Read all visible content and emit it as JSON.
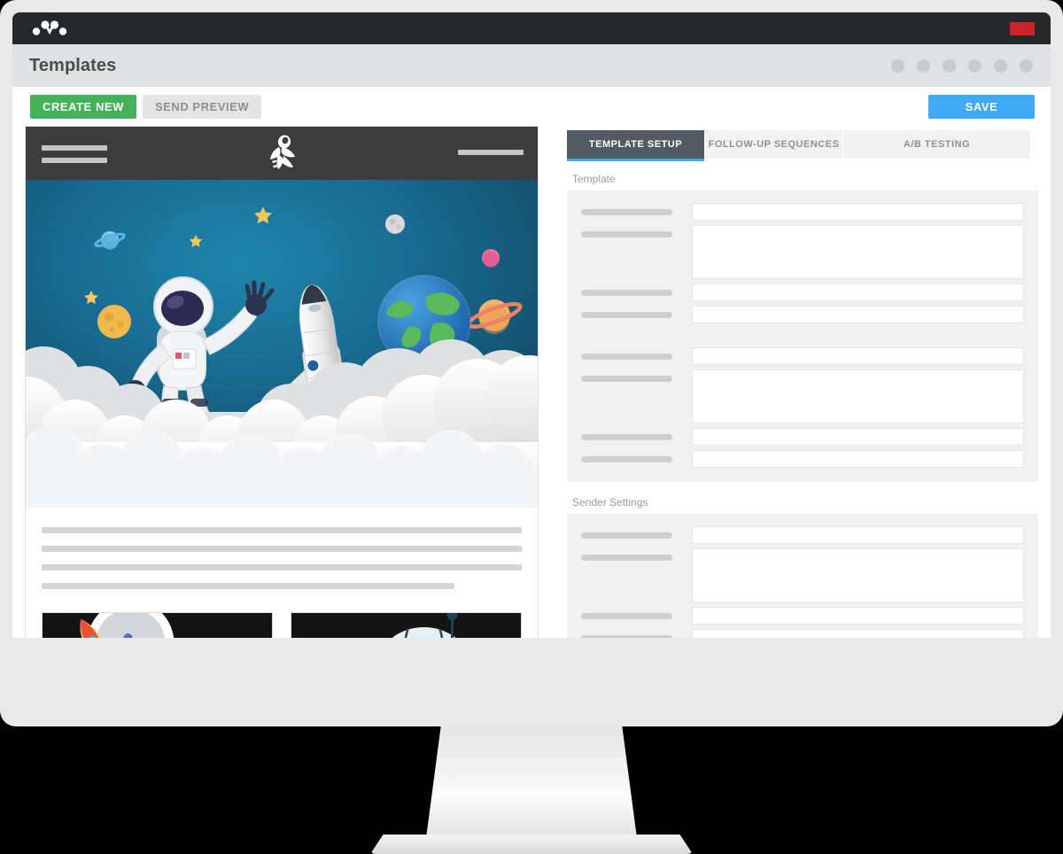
{
  "app": {
    "logo_icon": "mautic-logo-icon",
    "top_badge_icon": "red-badge-indicator",
    "page_title": "Templates",
    "header_dots_count": 6
  },
  "toolbar": {
    "create_new_label": "CREATE NEW",
    "send_preview_label": "SEND PREVIEW",
    "save_label": "SAVE"
  },
  "tabs": [
    {
      "label": "TEMPLATE SETUP",
      "active": true
    },
    {
      "label": "FOLLOW-UP SEQUENCES",
      "active": false
    },
    {
      "label": "A/B TESTING",
      "active": false
    }
  ],
  "sections": [
    {
      "label": "Template",
      "rows": [
        {
          "type": "input"
        },
        {
          "type": "textarea"
        },
        {
          "type": "input"
        },
        {
          "type": "input"
        },
        {
          "type": "gap"
        },
        {
          "type": "input"
        },
        {
          "type": "textarea"
        },
        {
          "type": "input"
        },
        {
          "type": "input"
        }
      ]
    },
    {
      "label": "Sender Settings",
      "rows": [
        {
          "type": "input"
        },
        {
          "type": "textarea"
        },
        {
          "type": "input"
        },
        {
          "type": "input"
        },
        {
          "type": "gap"
        },
        {
          "type": "input"
        },
        {
          "type": "textarea"
        },
        {
          "type": "input"
        },
        {
          "type": "input"
        }
      ]
    }
  ],
  "email_preview": {
    "header": {
      "logo_icon": "astronaut-rocket-logo-icon",
      "left_placeholder_lines": 2,
      "right_placeholder_lines": 1
    },
    "hero": {
      "alt": "paper-cut space scene with astronaut, space shuttle, earth and planets above clouds",
      "sky_color": "#16678c",
      "cloud_color": "#f2f2f2",
      "elements": [
        "astronaut",
        "space-shuttle",
        "earth-globe",
        "saturn-planet",
        "blue-planet",
        "moon",
        "orange-moon",
        "pink-planet",
        "stars"
      ]
    },
    "body_text_lines": 4,
    "image_cards": 2
  },
  "colors": {
    "brand_green": "#43b25a",
    "brand_blue": "#3fa9f5",
    "badge_red": "#cc2229",
    "appbar_dark": "#26292b",
    "tab_active": "#515b61",
    "titlebar": "#dee2e3"
  }
}
